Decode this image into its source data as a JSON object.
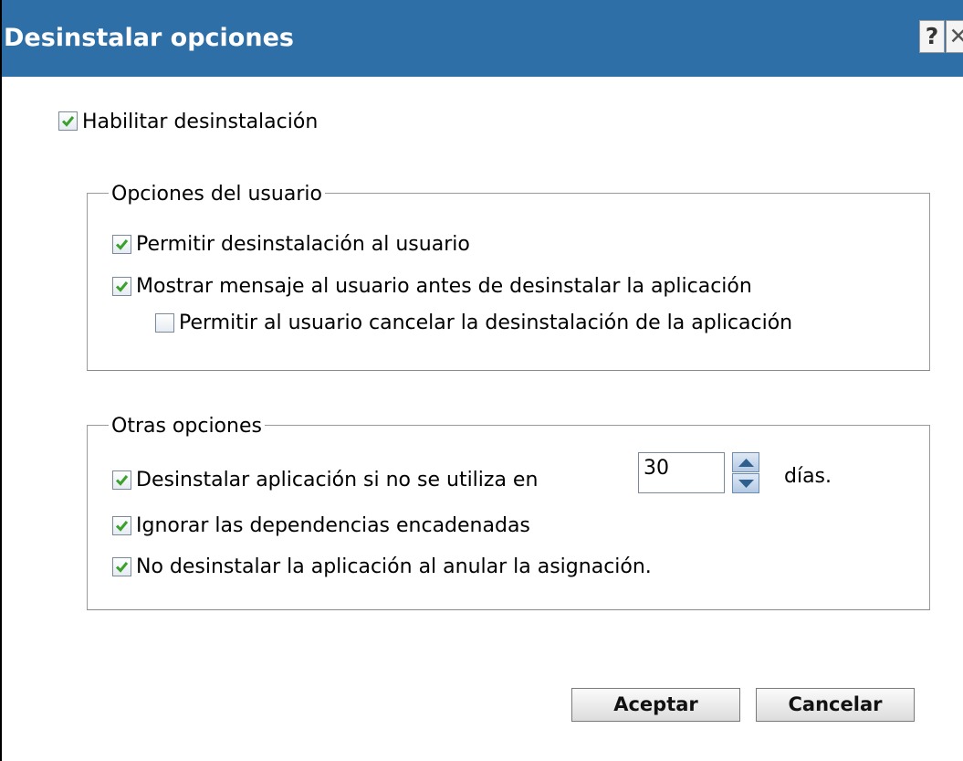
{
  "window": {
    "title": "Desinstalar opciones",
    "help_glyph": "?",
    "close_glyph": "✕"
  },
  "enable": {
    "label": "Habilitar desinstalación",
    "checked": true
  },
  "user_options": {
    "legend": "Opciones del usuario",
    "items": [
      {
        "label": "Permitir desinstalación al usuario",
        "checked": true
      },
      {
        "label": "Mostrar mensaje al usuario antes de desinstalar la aplicación",
        "checked": true
      },
      {
        "label": "Permitir al usuario cancelar la desinstalación de la aplicación",
        "checked": false
      }
    ]
  },
  "other_options": {
    "legend": "Otras opciones",
    "unused": {
      "label": "Desinstalar aplicación si no se utiliza en",
      "checked": true,
      "days_value": "30",
      "unit": "días."
    },
    "items": [
      {
        "label": "Ignorar las dependencias encadenadas",
        "checked": true
      },
      {
        "label": "No desinstalar la aplicación al anular la asignación.",
        "checked": true
      }
    ]
  },
  "buttons": {
    "ok": "Aceptar",
    "cancel": "Cancelar"
  },
  "colors": {
    "titlebar": "#2f6fa7",
    "checkmark": "#3aa12c"
  },
  "icons": {
    "help": "help-icon",
    "close": "close-icon",
    "check": "checkmark-icon",
    "spin_up": "arrow-up-icon",
    "spin_down": "arrow-down-icon"
  }
}
